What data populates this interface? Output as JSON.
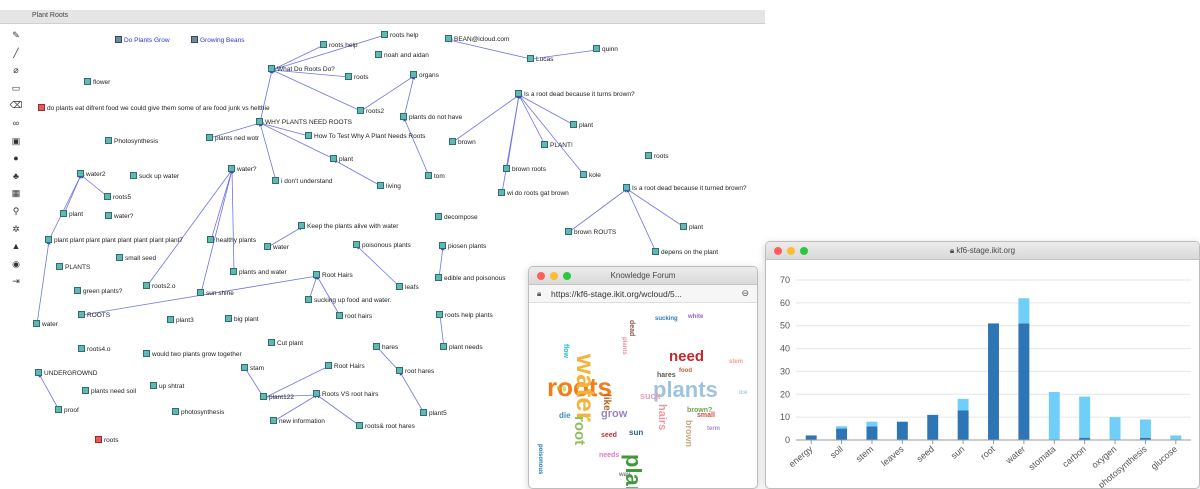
{
  "kf_view": {
    "title": "Plant Roots",
    "toolbar": [
      {
        "icon": "pencil-icon",
        "glyph": "✎"
      },
      {
        "icon": "line-icon",
        "glyph": "╱"
      },
      {
        "icon": "paperclip-icon",
        "glyph": "⌀"
      },
      {
        "icon": "rectangle-icon",
        "glyph": "▭"
      },
      {
        "icon": "eraser-icon",
        "glyph": "⌫"
      },
      {
        "icon": "link-icon",
        "glyph": "∞"
      },
      {
        "icon": "image-icon",
        "glyph": "▣"
      },
      {
        "icon": "person-icon",
        "glyph": "●"
      },
      {
        "icon": "group-icon",
        "glyph": "♣"
      },
      {
        "icon": "calendar-icon",
        "glyph": "▦"
      },
      {
        "icon": "search-icon",
        "glyph": "⚲"
      },
      {
        "icon": "gear-icon",
        "glyph": "✲"
      },
      {
        "icon": "flask-icon",
        "glyph": "▲"
      },
      {
        "icon": "lightbulb-icon",
        "glyph": "◉"
      },
      {
        "icon": "exit-icon",
        "glyph": "⇥"
      }
    ],
    "notes": [
      {
        "label": "Do Plants Grow",
        "kind": "view"
      },
      {
        "label": "Growing Beans",
        "kind": "view"
      },
      {
        "label": "roots help",
        "kind": "note"
      },
      {
        "label": "BEAN@icloud.com",
        "kind": "note"
      },
      {
        "label": "roots help",
        "kind": "note"
      },
      {
        "label": "noah and aidan",
        "kind": "note"
      },
      {
        "label": "quinn",
        "kind": "note"
      },
      {
        "label": "Lucas",
        "kind": "note"
      },
      {
        "label": "flower",
        "kind": "note"
      },
      {
        "label": "What Do Roots Do?",
        "kind": "note"
      },
      {
        "label": "roots",
        "kind": "note"
      },
      {
        "label": "organs",
        "kind": "note"
      },
      {
        "label": "Is a root dead because it turns brown?",
        "kind": "note"
      },
      {
        "label": "do plants eat difrent food we could give them some of are food junk vs helthie",
        "kind": "red"
      },
      {
        "label": "roots2",
        "kind": "note"
      },
      {
        "label": "plants do not have",
        "kind": "note"
      },
      {
        "label": "WHY PLANTS NEED ROOTS",
        "kind": "note"
      },
      {
        "label": "plant",
        "kind": "note"
      },
      {
        "label": "Photosynthesis",
        "kind": "note"
      },
      {
        "label": "plants ned wotr",
        "kind": "note"
      },
      {
        "label": "How To Test Why A Plant Needs Roots",
        "kind": "note"
      },
      {
        "label": "brown",
        "kind": "note"
      },
      {
        "label": "PLANT!",
        "kind": "note"
      },
      {
        "label": "roots",
        "kind": "note"
      },
      {
        "label": "plant",
        "kind": "note"
      },
      {
        "label": "water2",
        "kind": "note"
      },
      {
        "label": "suck up water",
        "kind": "note"
      },
      {
        "label": "water?",
        "kind": "note"
      },
      {
        "label": "i don't understand",
        "kind": "note"
      },
      {
        "label": "living",
        "kind": "note"
      },
      {
        "label": "tom",
        "kind": "note"
      },
      {
        "label": "brown roots",
        "kind": "note"
      },
      {
        "label": "kole",
        "kind": "note"
      },
      {
        "label": "roots5",
        "kind": "note"
      },
      {
        "label": "Is a root dead because it turned brown?",
        "kind": "note"
      },
      {
        "label": "wi do roots gat brown",
        "kind": "note"
      },
      {
        "label": "plant",
        "kind": "note"
      },
      {
        "label": "water?",
        "kind": "note"
      },
      {
        "label": "decompose",
        "kind": "note"
      },
      {
        "label": "Keep the plants alive with water",
        "kind": "note"
      },
      {
        "label": "brown ROUTS",
        "kind": "note"
      },
      {
        "label": "plant",
        "kind": "note"
      },
      {
        "label": "plant plant plant plant plant plant plant plant7",
        "kind": "note"
      },
      {
        "label": "healthy plants",
        "kind": "note"
      },
      {
        "label": "water",
        "kind": "note"
      },
      {
        "label": "poisonous plants",
        "kind": "note"
      },
      {
        "label": "piosen plants",
        "kind": "note"
      },
      {
        "label": "small seed",
        "kind": "note"
      },
      {
        "label": "depens on the plant",
        "kind": "note"
      },
      {
        "label": "PLANTS",
        "kind": "note"
      },
      {
        "label": "plants and water",
        "kind": "note"
      },
      {
        "label": "Root Hairs",
        "kind": "note"
      },
      {
        "label": "edible and poisonous",
        "kind": "note"
      },
      {
        "label": "roots2.o",
        "kind": "note"
      },
      {
        "label": "green plants?",
        "kind": "note"
      },
      {
        "label": "sun shine",
        "kind": "note"
      },
      {
        "label": "sucking up food and water.",
        "kind": "note"
      },
      {
        "label": "leafs",
        "kind": "note"
      },
      {
        "label": "ROOTS",
        "kind": "note"
      },
      {
        "label": "plant3",
        "kind": "note"
      },
      {
        "label": "big plant",
        "kind": "note"
      },
      {
        "label": "root hairs",
        "kind": "note"
      },
      {
        "label": "roots help plants",
        "kind": "note"
      },
      {
        "label": "water",
        "kind": "note"
      },
      {
        "label": "Cut plant",
        "kind": "note"
      },
      {
        "label": "plant needs",
        "kind": "note"
      },
      {
        "label": "roots4.o",
        "kind": "note"
      },
      {
        "label": "would two plants grow together",
        "kind": "note"
      },
      {
        "label": "hares",
        "kind": "note"
      },
      {
        "label": "stam",
        "kind": "note"
      },
      {
        "label": "Root Hairs",
        "kind": "note"
      },
      {
        "label": "UNDERGROWND",
        "kind": "note"
      },
      {
        "label": "root hares",
        "kind": "note"
      },
      {
        "label": "up shtrat",
        "kind": "note"
      },
      {
        "label": "plants need soil",
        "kind": "note"
      },
      {
        "label": "plant122",
        "kind": "note"
      },
      {
        "label": "Roots VS root hairs",
        "kind": "note"
      },
      {
        "label": "proof",
        "kind": "note"
      },
      {
        "label": "photosynthesis",
        "kind": "note"
      },
      {
        "label": "plant5",
        "kind": "note"
      },
      {
        "label": "new information",
        "kind": "note"
      },
      {
        "label": "roots& root hares",
        "kind": "note"
      },
      {
        "label": "roots",
        "kind": "red"
      }
    ]
  },
  "wordcloud_window": {
    "title": "Knowledge Forum",
    "url": "https://kf6-stage.ikit.org/wcloud/5...",
    "lock_icon": "lock-icon",
    "zoom_icon": "zoom-icon",
    "words": [
      {
        "text": "roots",
        "color": "#f07d1a"
      },
      {
        "text": "water",
        "color": "#f4b43c"
      },
      {
        "text": "plants",
        "color": "#9ec3de"
      },
      {
        "text": "plant",
        "color": "#3f9a3a"
      },
      {
        "text": "need",
        "color": "#c9262c"
      },
      {
        "text": "root",
        "color": "#8fbf5c"
      },
      {
        "text": "grow",
        "color": "#9a84c0"
      },
      {
        "text": "hairs",
        "color": "#e89aa0"
      },
      {
        "text": "suck",
        "color": "#e3a3b6"
      },
      {
        "text": "like",
        "color": "#b5651d"
      },
      {
        "text": "brown",
        "color": "#c8a97e"
      },
      {
        "text": "hares",
        "color": "#555555"
      },
      {
        "text": "small",
        "color": "#d94a45"
      },
      {
        "text": "brown?",
        "color": "#6aa34b"
      },
      {
        "text": "sucking",
        "color": "#2f7fb8"
      },
      {
        "text": "white",
        "color": "#9467bd"
      },
      {
        "text": "die",
        "color": "#3a8fb7"
      },
      {
        "text": "sun",
        "color": "#2a6099"
      },
      {
        "text": "food",
        "color": "#c45a3a"
      },
      {
        "text": "poisonous",
        "color": "#1f77b4"
      },
      {
        "text": "seed",
        "color": "#d62728"
      },
      {
        "text": "term",
        "color": "#b08ac8"
      },
      {
        "text": "plants",
        "color": "#e7969c"
      },
      {
        "text": "stem",
        "color": "#ff9896"
      },
      {
        "text": "dead",
        "color": "#8c564b"
      },
      {
        "text": "big",
        "color": "#bcbd22"
      },
      {
        "text": "needs",
        "color": "#e377c2"
      },
      {
        "text": "flow",
        "color": "#17becf"
      },
      {
        "text": "way",
        "color": "#7f7f7f"
      },
      {
        "text": "ice",
        "color": "#aec7e8"
      }
    ]
  },
  "chart_window": {
    "title": "kf6-stage.ikit.org",
    "lock_icon": "lock-icon"
  },
  "chart_data": {
    "type": "bar",
    "categories": [
      "energy",
      "soil",
      "stem",
      "leaves",
      "seed",
      "sun",
      "root",
      "water",
      "stomata",
      "carbon",
      "oxygen",
      "photosynthesis",
      "glucose"
    ],
    "series": [
      {
        "values": [
          2,
          5,
          6,
          8,
          11,
          13,
          51,
          51,
          0,
          1,
          0,
          1,
          0
        ],
        "color": "#2e75b6"
      },
      {
        "values": [
          0,
          1,
          2,
          0,
          0,
          5,
          0,
          11,
          21,
          18,
          10,
          8,
          2
        ],
        "color": "#6fcff8"
      }
    ],
    "stacked": true,
    "ylim": [
      0,
      70
    ],
    "yticks": [
      0,
      10,
      20,
      30,
      40,
      50,
      60,
      70
    ],
    "grid": true
  }
}
